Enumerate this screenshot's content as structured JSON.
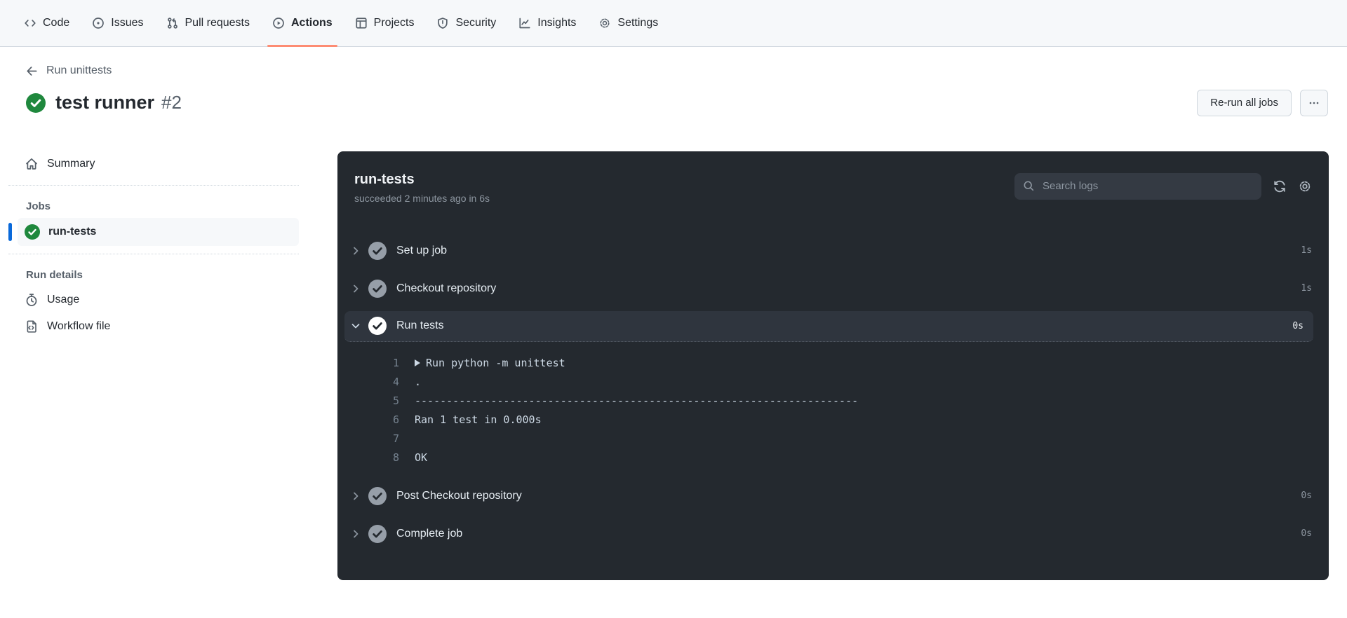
{
  "colors": {
    "nav-bg": "#f6f8fa",
    "nav-border": "#d0d7de",
    "accent-orange": "#fd8c73",
    "accent-blue": "#0969da",
    "success-green": "#1f883d",
    "panel-bg": "#24292f",
    "panel-highlight": "#2f353e",
    "search-bg": "#343a43",
    "text-primary": "#24292f",
    "text-secondary": "#57606a",
    "panel-text": "#e6edf3",
    "panel-muted": "#8d96a0",
    "log-text": "#cdd9e5",
    "log-gutter": "#768390",
    "step-circle": "#969ea8"
  },
  "nav": {
    "items": [
      {
        "label": "Code"
      },
      {
        "label": "Issues"
      },
      {
        "label": "Pull requests"
      },
      {
        "label": "Actions",
        "active": true
      },
      {
        "label": "Projects"
      },
      {
        "label": "Security"
      },
      {
        "label": "Insights"
      },
      {
        "label": "Settings"
      }
    ]
  },
  "header": {
    "back_label": "Run unittests",
    "title": "test runner",
    "run_number": "#2",
    "rerun_button_label": "Re-run all jobs"
  },
  "sidebar": {
    "summary_label": "Summary",
    "jobs_section_label": "Jobs",
    "job": {
      "label": "run-tests",
      "status": "succeeded"
    },
    "run_details_label": "Run details",
    "usage_label": "Usage",
    "workflow_file_label": "Workflow file"
  },
  "job_panel": {
    "title": "run-tests",
    "subtitle": "succeeded 2 minutes ago in 6s",
    "search_placeholder": "Search logs",
    "steps": [
      {
        "label": "Set up job",
        "duration": "1s",
        "expanded": false
      },
      {
        "label": "Checkout repository",
        "duration": "1s",
        "expanded": false
      },
      {
        "label": "Run tests",
        "duration": "0s",
        "expanded": true
      },
      {
        "label": "Post Checkout repository",
        "duration": "0s",
        "expanded": false
      },
      {
        "label": "Complete job",
        "duration": "0s",
        "expanded": false
      }
    ],
    "log_lines": [
      {
        "number": "1",
        "text": "Run python -m unittest"
      },
      {
        "number": "4",
        "text": "."
      },
      {
        "number": "5",
        "text": "----------------------------------------------------------------------"
      },
      {
        "number": "6",
        "text": "Ran 1 test in 0.000s"
      },
      {
        "number": "7",
        "text": ""
      },
      {
        "number": "8",
        "text": "OK"
      }
    ]
  }
}
